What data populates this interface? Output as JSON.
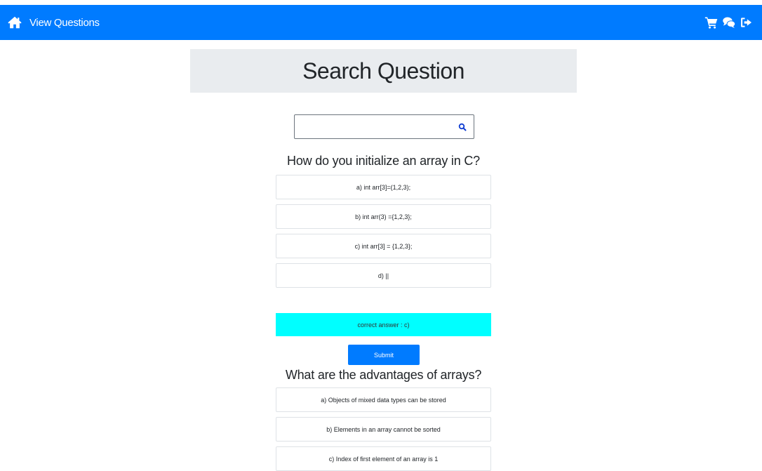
{
  "navbar": {
    "brand_label": "View Questions",
    "icons": [
      "home-icon",
      "cart-icon",
      "chat-icon",
      "logout-icon"
    ],
    "background": "#007bff"
  },
  "header": {
    "title": "Search Question"
  },
  "search": {
    "value": "",
    "placeholder": ""
  },
  "questions": [
    {
      "title": "How do you initialize an array in C?",
      "options": [
        "a) int arr[3]=(1,2,3);",
        "b) int arr(3) ={1,2,3};",
        "c) int arr[3] = {1,2,3};",
        "d) ||"
      ],
      "answer": "correct answer : c)",
      "submit_label": "Submit"
    },
    {
      "title": "What are the advantages of arrays?",
      "options": [
        "a) Objects of mixed data types can be stored",
        "b) Elements in an array cannot be sorted",
        "c) Index of first element of an array is 1"
      ]
    }
  ],
  "colors": {
    "primary": "#007bff",
    "answer_highlight": "#00ffff",
    "jumbotron": "#e9ecef"
  }
}
